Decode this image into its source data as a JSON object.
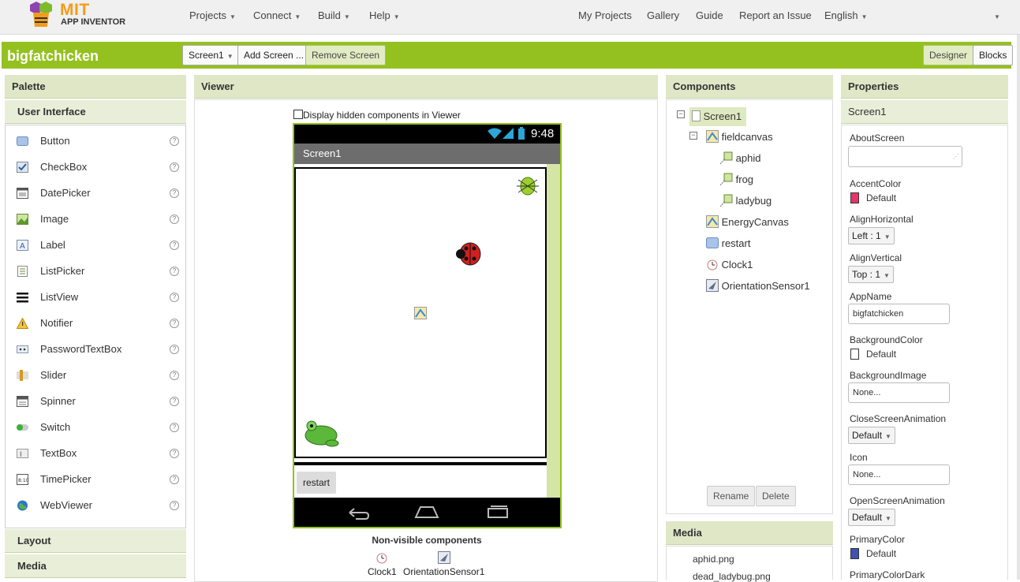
{
  "topbar": {
    "logo_title": "MIT",
    "logo_sub": "APP INVENTOR",
    "menus": [
      {
        "label": "Projects"
      },
      {
        "label": "Connect"
      },
      {
        "label": "Build"
      },
      {
        "label": "Help"
      }
    ],
    "links": [
      {
        "label": "My Projects"
      },
      {
        "label": "Gallery"
      },
      {
        "label": "Guide"
      },
      {
        "label": "Report an Issue"
      }
    ],
    "language": "English"
  },
  "projectbar": {
    "project_name": "bigfatchicken",
    "screen_select": "Screen1",
    "add_screen": "Add Screen ...",
    "remove_screen": "Remove Screen",
    "designer": "Designer",
    "blocks": "Blocks"
  },
  "palette": {
    "header": "Palette",
    "section": "User Interface",
    "items": [
      {
        "label": "Button",
        "icon": "button-icon"
      },
      {
        "label": "CheckBox",
        "icon": "checkbox-icon"
      },
      {
        "label": "DatePicker",
        "icon": "datepicker-icon"
      },
      {
        "label": "Image",
        "icon": "image-icon"
      },
      {
        "label": "Label",
        "icon": "label-icon"
      },
      {
        "label": "ListPicker",
        "icon": "listpicker-icon"
      },
      {
        "label": "ListView",
        "icon": "listview-icon"
      },
      {
        "label": "Notifier",
        "icon": "notifier-icon"
      },
      {
        "label": "PasswordTextBox",
        "icon": "passwordtextbox-icon"
      },
      {
        "label": "Slider",
        "icon": "slider-icon"
      },
      {
        "label": "Spinner",
        "icon": "spinner-icon"
      },
      {
        "label": "Switch",
        "icon": "switch-icon"
      },
      {
        "label": "TextBox",
        "icon": "textbox-icon"
      },
      {
        "label": "TimePicker",
        "icon": "timepicker-icon"
      },
      {
        "label": "WebViewer",
        "icon": "webviewer-icon"
      }
    ],
    "help": "?",
    "layout": "Layout",
    "media": "Media"
  },
  "viewer": {
    "header": "Viewer",
    "hidden_checkbox_label": "Display hidden components in Viewer",
    "status_time": "9:48",
    "screen_title": "Screen1",
    "restart_button": "restart",
    "nonvisible_title": "Non-visible components",
    "nonvisible": [
      {
        "label": "Clock1"
      },
      {
        "label": "OrientationSensor1"
      }
    ]
  },
  "components": {
    "header": "Components",
    "tree": [
      {
        "label": "Screen1"
      },
      {
        "label": "fieldcanvas"
      },
      {
        "label": "aphid"
      },
      {
        "label": "frog"
      },
      {
        "label": "ladybug"
      },
      {
        "label": "EnergyCanvas"
      },
      {
        "label": "restart"
      },
      {
        "label": "Clock1"
      },
      {
        "label": "OrientationSensor1"
      }
    ],
    "rename": "Rename",
    "delete": "Delete"
  },
  "media": {
    "header": "Media",
    "files": [
      {
        "label": "aphid.png"
      },
      {
        "label": "dead_ladybug.png"
      }
    ]
  },
  "properties": {
    "header": "Properties",
    "selected": "Screen1",
    "about_label": "AboutScreen",
    "accent_label": "AccentColor",
    "accent_value": "Default",
    "accent_color": "#e8336b",
    "alignh_label": "AlignHorizontal",
    "alignh_value": "Left : 1",
    "alignv_label": "AlignVertical",
    "alignv_value": "Top : 1",
    "appname_label": "AppName",
    "appname_value": "bigfatchicken",
    "bgcolor_label": "BackgroundColor",
    "bgcolor_value": "Default",
    "bgimage_label": "BackgroundImage",
    "bgimage_value": "None...",
    "closeanim_label": "CloseScreenAnimation",
    "closeanim_value": "Default",
    "icon_label": "Icon",
    "icon_value": "None...",
    "openanim_label": "OpenScreenAnimation",
    "openanim_value": "Default",
    "primary_label": "PrimaryColor",
    "primary_value": "Default",
    "primary_color": "#3f51b5",
    "primarydark_label": "PrimaryColorDark"
  },
  "colors": {
    "accent_green": "#94c11f",
    "panel_header": "#dfe7c6"
  }
}
